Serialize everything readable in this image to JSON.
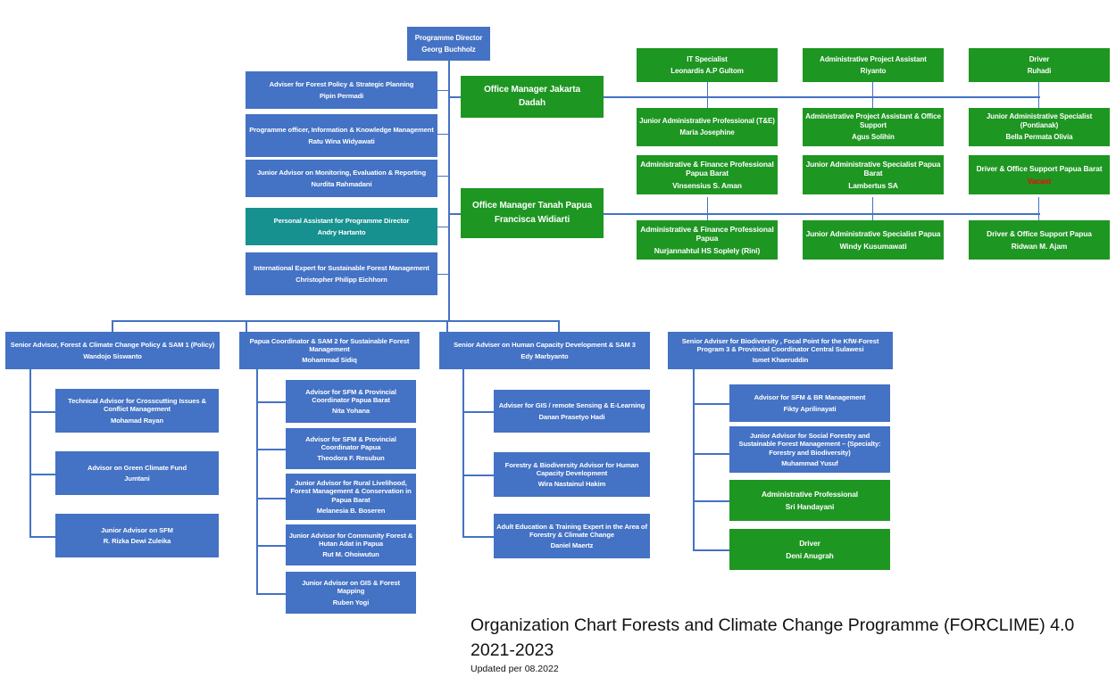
{
  "caption": {
    "main_line1": "Organization Chart Forests and Climate Change Programme (FORCLIME) 4.0",
    "main_line2": "2021-2023",
    "updated": "Updated per 08.2022"
  },
  "colors": {
    "blue": "#4472C4",
    "green": "#1E9622",
    "teal": "#16918F",
    "vacant_red": "#FF0000",
    "connector": "#4472C4",
    "background": "#FFFFFF"
  },
  "director": {
    "title": "Programme Director",
    "person": "Georg Buchholz"
  },
  "office_managers": [
    {
      "title": "Office Manager Jakarta",
      "person": "Dadah"
    },
    {
      "title": "Office Manager Tanah Papua",
      "person": "Francisca Widiarti"
    }
  ],
  "director_staff": [
    {
      "title": "Adviser for Forest Policy & Strategic Planning",
      "person": "Pipin Permadi",
      "color": "blue"
    },
    {
      "title": "Programme officer, Information & Knowledge Management",
      "person": "Ratu Wina Widyawati",
      "color": "blue"
    },
    {
      "title": "Junior Advisor on Monitoring, Evaluation & Reporting",
      "person": "Nurdita Rahmadani",
      "color": "blue"
    },
    {
      "title": "Personal Assistant for Programme Director",
      "person": "Andry Hartanto",
      "color": "teal"
    },
    {
      "title": "International Expert for Sustainable Forest Management",
      "person": "Christopher Philipp Eichhorn",
      "color": "blue"
    }
  ],
  "jakarta_staff": [
    {
      "title": "IT Specialist",
      "person": "Leonardis A.P Gultom"
    },
    {
      "title": "Administrative Project Assistant",
      "person": "Riyanto"
    },
    {
      "title": "Driver",
      "person": "Ruhadi"
    },
    {
      "title": "Junior Administrative Professional (T&E)",
      "person": "Maria Josephine"
    },
    {
      "title": "Administrative Project Assistant & Office Support",
      "person": "Agus Solihin"
    },
    {
      "title": "Junior Administrative Specialist (Pontianak)",
      "person": "Bella Permata Olivia"
    }
  ],
  "papua_staff": [
    {
      "title": "Administrative & Finance Professional Papua Barat",
      "person": "Vinsensius S. Aman",
      "vacant": false
    },
    {
      "title": "Junior Administrative Specialist Papua Barat",
      "person": "Lambertus SA",
      "vacant": false
    },
    {
      "title": "Driver & Office Support Papua Barat",
      "person": "Vacant",
      "vacant": true
    },
    {
      "title": "Administrative & Finance Professional Papua",
      "person": "Nurjannahtul HS Soplely (Rini)",
      "vacant": false
    },
    {
      "title": "Junior Administrative Specialist Papua",
      "person": "Windy Kusumawati",
      "vacant": false
    },
    {
      "title": "Driver & Office Support Papua",
      "person": "Ridwan M. Ajam",
      "vacant": false
    }
  ],
  "sam1": {
    "head": {
      "title": "Senior Advisor, Forest & Climate Change Policy & SAM 1 (Policy)",
      "person": "Wandojo Siswanto"
    },
    "reports": [
      {
        "title": "Technical Advisor for Crosscutting Issues & Conflict Management",
        "person": "Mohamad Rayan",
        "color": "blue"
      },
      {
        "title": "Advisor on Green Climate Fund",
        "person": "Jumtani",
        "color": "blue"
      },
      {
        "title": "Junior Advisor on SFM",
        "person": "R. Rizka Dewi Zuleika",
        "color": "blue"
      }
    ]
  },
  "sam2": {
    "head": {
      "title": "Papua Coordinator & SAM 2 for Sustainable Forest Management",
      "person": "Mohammad Sidiq"
    },
    "reports": [
      {
        "title": "Advisor for SFM & Provincial Coordinator Papua Barat",
        "person": "Nita Yohana",
        "color": "blue"
      },
      {
        "title": "Advisor for SFM & Provincial Coordinator Papua",
        "person": "Theodora F. Resubun",
        "color": "blue"
      },
      {
        "title": "Junior Advisor for Rural Livelihood, Forest Management & Conservation in Papua Barat",
        "person": "Melanesia B. Boseren",
        "color": "blue"
      },
      {
        "title": "Junior Advisor for Community Forest & Hutan Adat in Papua",
        "person": "Rut M. Ohoiwutun",
        "color": "blue"
      },
      {
        "title": "Junior Advisor on GIS & Forest Mapping",
        "person": "Ruben Yogi",
        "color": "blue"
      }
    ]
  },
  "sam3": {
    "head": {
      "title": "Senior Adviser on Human Capacity Development & SAM 3",
      "person": "Edy Marbyanto"
    },
    "reports": [
      {
        "title": "Adviser for GIS / remote Sensing & E-Learning",
        "person": "Danan Prasetyo Hadi",
        "color": "blue"
      },
      {
        "title": "Forestry & Biodiversity Advisor for Human Capacity Development",
        "person": "Wira Nastainul Hakim",
        "color": "blue"
      },
      {
        "title": "Adult Education & Training Expert in the Area of Forestry & Climate Change",
        "person": "Daniel Maertz",
        "color": "blue"
      }
    ]
  },
  "sam4": {
    "head": {
      "title": "Senior Adviser for Biodiversity , Focal Point for the KfW-Forest Program 3 & Provincial Coordinator Central Sulawesi",
      "person": "Ismet Khaeruddin"
    },
    "reports": [
      {
        "title": "Advisor for SFM & BR Management",
        "person": "Fikty Aprilinayati",
        "color": "blue"
      },
      {
        "title": "Junior Advisor  for Social Forestry and Sustainable Forest Management – (Specialty: Forestry and Biodiversity)",
        "person": "Muhammad Yusuf",
        "color": "blue"
      },
      {
        "title": "Administrative Professional",
        "person": "Sri Handayani",
        "color": "green"
      },
      {
        "title": "Driver",
        "person": "Deni Anugrah",
        "color": "green"
      }
    ]
  }
}
